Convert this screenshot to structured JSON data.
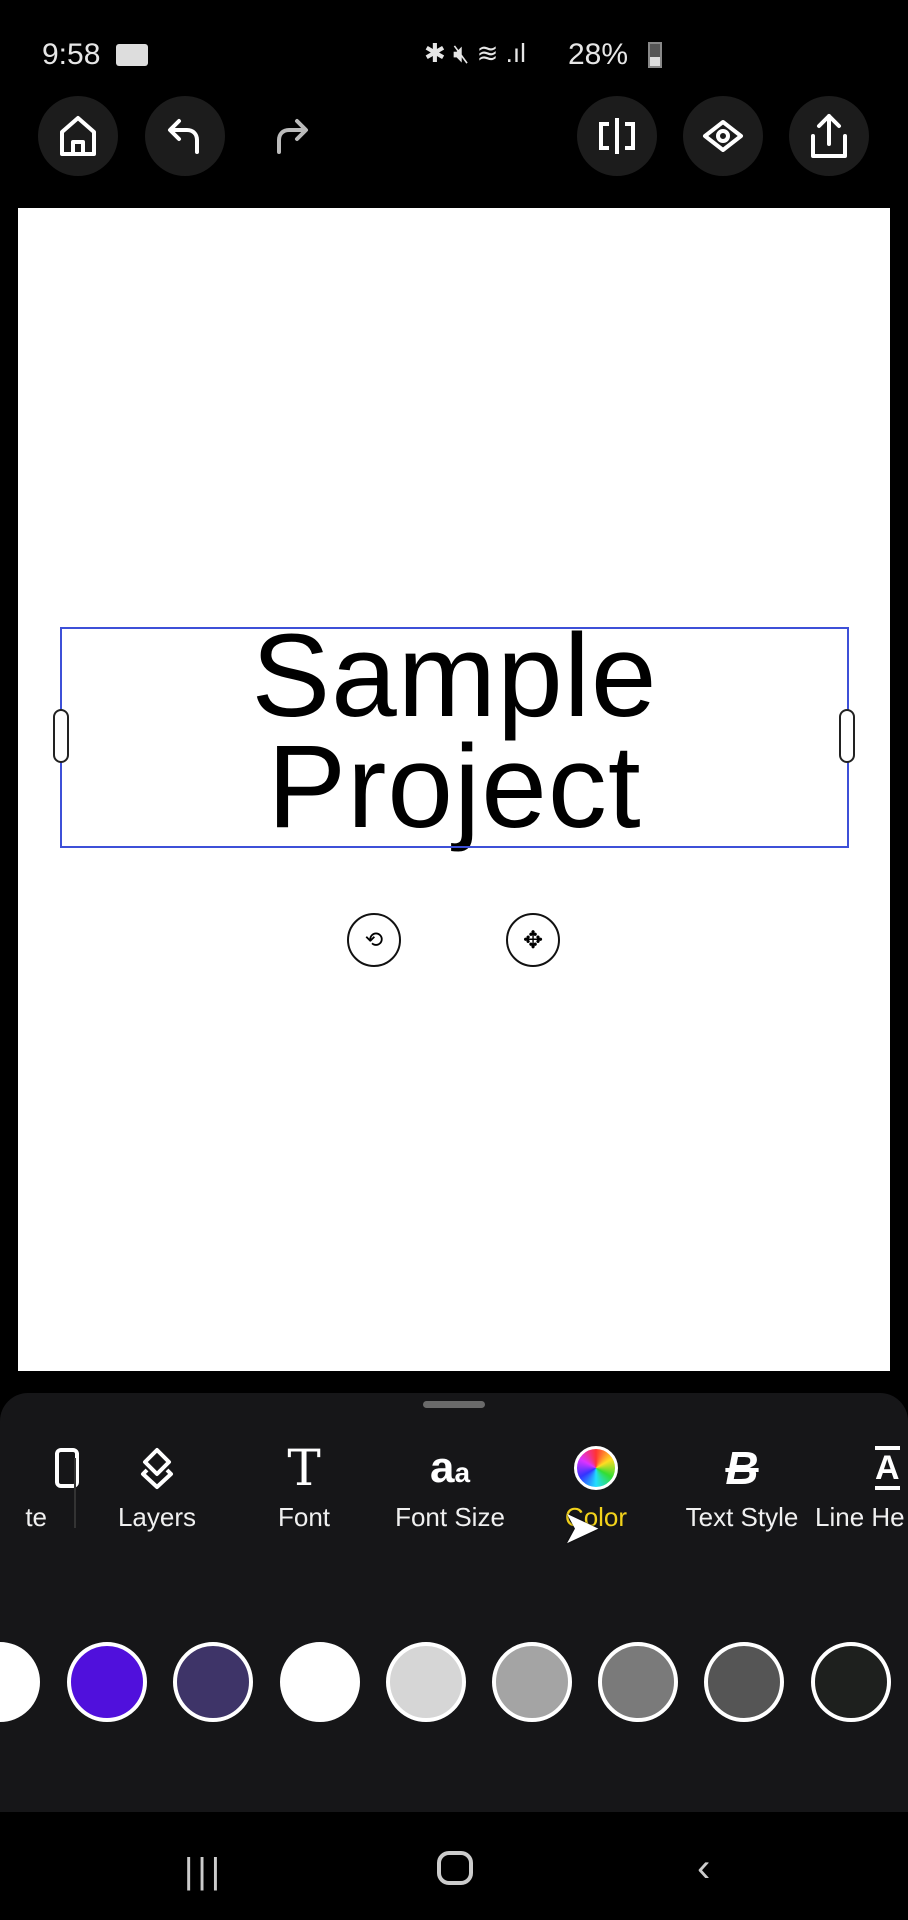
{
  "status_bar": {
    "time": "9:58",
    "battery": "28%"
  },
  "top_bar": {
    "icons": [
      "home-icon",
      "undo-icon",
      "redo-icon",
      "split-icon",
      "preview-eye-icon",
      "share-icon"
    ]
  },
  "canvas": {
    "text_line1": "Sample",
    "text_line2": "Project",
    "selection_color": "#3d50d8"
  },
  "toolbar": {
    "items": [
      {
        "label": "te",
        "icon": "partial-icon"
      },
      {
        "label": "Layers",
        "icon": "layers-icon"
      },
      {
        "label": "Font",
        "icon": "font-icon"
      },
      {
        "label": "Font Size",
        "icon": "font-size-icon"
      },
      {
        "label": "Color",
        "icon": "color-wheel-icon",
        "active": true
      },
      {
        "label": "Text Style",
        "icon": "text-style-icon"
      },
      {
        "label": "Line He",
        "icon": "line-height-icon"
      }
    ],
    "active_color": "#f2d21b"
  },
  "swatches": [
    "#ffffff",
    "#5010dc",
    "#3e3468",
    "#ffffff",
    "#d6d6d6",
    "#a4a4a4",
    "#7a7a7a",
    "#555555",
    "#1e201e"
  ]
}
